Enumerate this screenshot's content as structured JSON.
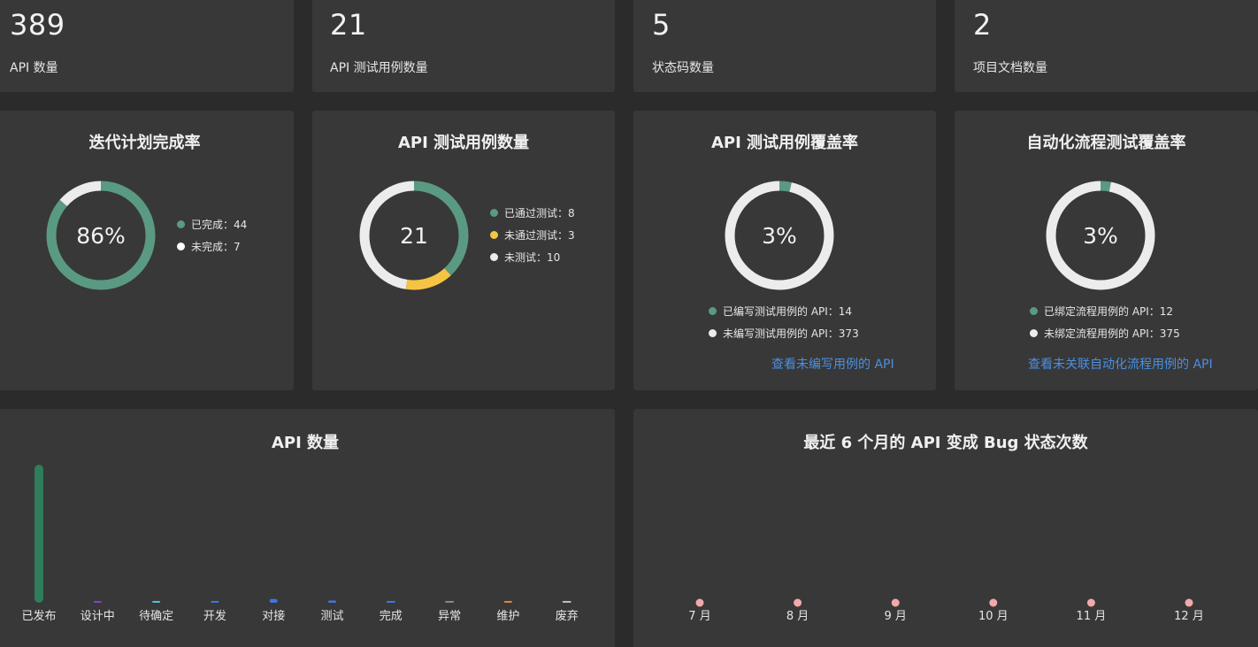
{
  "stats": [
    {
      "value": "389",
      "label": "API 数量"
    },
    {
      "value": "21",
      "label": "API 测试用例数量"
    },
    {
      "value": "5",
      "label": "状态码数量"
    },
    {
      "value": "2",
      "label": "项目文档数量"
    }
  ],
  "iteration": {
    "title": "迭代计划完成率",
    "center": "86%",
    "legend": [
      "已完成：44",
      "未完成：7"
    ],
    "completed": 44,
    "uncompleted": 7,
    "colors": {
      "completed": "#5a9a82",
      "uncompleted": "#ececec"
    }
  },
  "test_cases": {
    "title": "API 测试用例数量",
    "center": "21",
    "legend": [
      "已通过测试：8",
      "未通过测试：3",
      "未测试：10"
    ],
    "passed": 8,
    "failed": 3,
    "untested": 10,
    "colors": {
      "passed": "#5a9a82",
      "failed": "#f5c443",
      "untested": "#ececec"
    }
  },
  "coverage": {
    "title": "API 测试用例覆盖率",
    "center": "3%",
    "legend": [
      "已编写测试用例的 API：14",
      "未编写测试用例的 API：373"
    ],
    "written": 14,
    "unwritten": 373,
    "link": "查看未编写用例的 API"
  },
  "flow_coverage": {
    "title": "自动化流程测试覆盖率",
    "center": "3%",
    "legend": [
      "已绑定流程用例的 API：12",
      "未绑定流程用例的 API：375"
    ],
    "bound": 12,
    "unbound": 375,
    "link": "查看未关联自动化流程用例的 API"
  },
  "colors": {
    "green": "#5a9a82",
    "white": "#ececec",
    "yellow": "#f5c443",
    "link": "#4a90e2",
    "pink": "#f3a9a9"
  },
  "chart_data": [
    {
      "type": "bar",
      "title": "API 数量",
      "categories": [
        "已发布",
        "设计中",
        "待确定",
        "开发",
        "对接",
        "测试",
        "完成",
        "异常",
        "维护",
        "废弃"
      ],
      "values": [
        366,
        1,
        3,
        4,
        10,
        6,
        0,
        0,
        1,
        0
      ],
      "colors": [
        "#2f7d5b",
        "#8a3fd1",
        "#4cc3d9",
        "#3f76e0",
        "#3f76e0",
        "#3f76e0",
        "#3f76e0",
        "#888888",
        "#e0863c",
        "#bdbdbd"
      ],
      "ylim": [
        0,
        366
      ]
    },
    {
      "type": "scatter",
      "title": "最近 6 个月的 API 变成 Bug 状态次数",
      "categories": [
        "7 月",
        "8 月",
        "9 月",
        "10 月",
        "11 月",
        "12 月"
      ],
      "values": [
        0,
        0,
        0,
        0,
        0,
        0
      ],
      "color": "#f3a9a9"
    }
  ]
}
